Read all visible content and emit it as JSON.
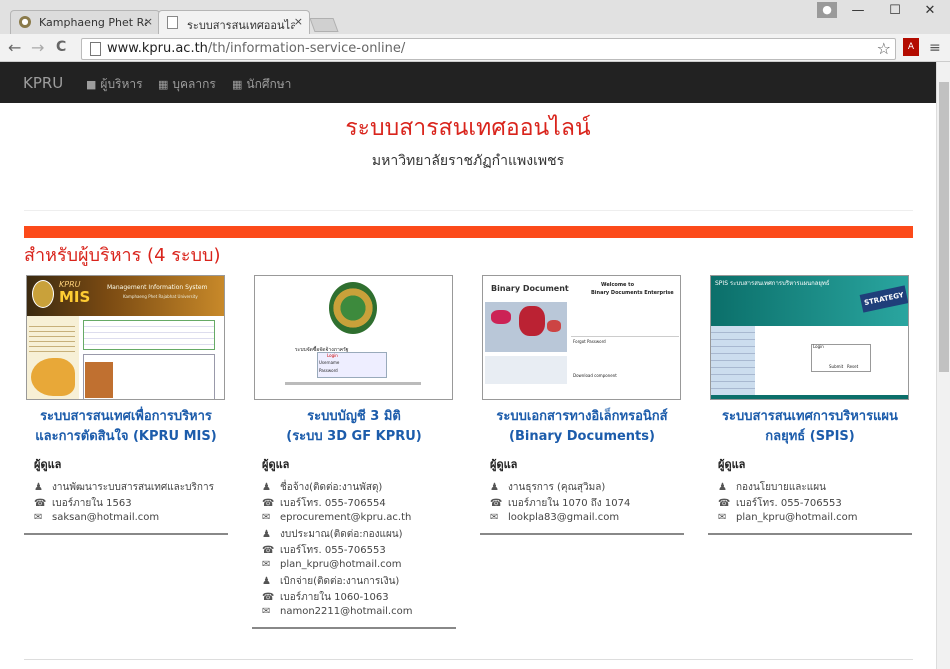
{
  "browser": {
    "tabs": [
      {
        "title": "Kamphaeng Phet Rajabha",
        "close": "×"
      },
      {
        "title": "ระบบสารสนเทศออนไลน์ - มหา",
        "close": "×"
      }
    ],
    "url_host": "www.kpru.ac.th",
    "url_path": "/th/information-service-online/",
    "back": "←",
    "forward": "→",
    "reload": "C",
    "star": "☆",
    "menu": "≡",
    "pdf": "A",
    "win_min": "—",
    "win_max": "☐",
    "win_close": "✕"
  },
  "navbar": {
    "brand": "KPRU",
    "links": [
      {
        "label": "ผู้บริหาร",
        "icon": "user-icon"
      },
      {
        "label": "บุคลากร",
        "icon": "grid-icon"
      },
      {
        "label": "นักศึกษา",
        "icon": "grid-icon"
      }
    ]
  },
  "header": {
    "title": "ระบบสารสนเทศออนไลน์",
    "subtitle": "มหาวิทยาลัยราชภัฏกำแพงเพชร"
  },
  "section": {
    "title": "สำหรับผู้บริหาร (4 ระบบ)"
  },
  "cards": [
    {
      "title1": "ระบบสารสนเทศเพื่อการบริหาร",
      "title2": "และการตัดสินใจ (KPRU MIS)",
      "contact_head": "ผู้ดูแล",
      "rows": [
        {
          "icon": "user-icon",
          "text": "งานพัฒนาระบบสารสนเทศและบริการ"
        },
        {
          "icon": "phone-icon",
          "text": "เบอร์ภายใน   1563"
        },
        {
          "icon": "envelope-icon",
          "text": "saksan@hotmail.com"
        }
      ]
    },
    {
      "title1": "ระบบบัญชี 3 มิติ",
      "title2": "(ระบบ 3D GF KPRU)",
      "contact_head": "ผู้ดูแล",
      "rows": [
        {
          "icon": "user-icon",
          "text": "ชื่อจ้าง(ติดต่อ:งานพัสดุ)"
        },
        {
          "icon": "phone-icon",
          "text": "เบอร์โทร.   055-706554"
        },
        {
          "icon": "envelope-icon",
          "text": "eprocurement@kpru.ac.th"
        },
        {
          "icon": "user-icon",
          "text": "งบประมาณ(ติดต่อ:กองแผน)"
        },
        {
          "icon": "phone-icon",
          "text": "เบอร์โทร.   055-706553"
        },
        {
          "icon": "envelope-icon",
          "text": "plan_kpru@hotmail.com"
        },
        {
          "icon": "user-icon",
          "text": "เบิกจ่าย(ติดต่อ:งานการเงิน)"
        },
        {
          "icon": "phone-icon",
          "text": "เบอร์ภายใน   1060-1063"
        },
        {
          "icon": "envelope-icon",
          "text": "namon2211@hotmail.com"
        }
      ]
    },
    {
      "title1": "ระบบเอกสารทางอิเล็กทรอนิกส์",
      "title2": "(Binary Documents)",
      "contact_head": "ผู้ดูแล",
      "rows": [
        {
          "icon": "user-icon",
          "text": "งานธุรการ   (คุณสุวิมล)"
        },
        {
          "icon": "phone-icon",
          "text": "เบอร์ภายใน   1070   ถึง   1074"
        },
        {
          "icon": "envelope-icon",
          "text": "lookpla83@gmail.com"
        }
      ]
    },
    {
      "title1": "ระบบสารสนเทศการบริหารแผน",
      "title2": "กลยุทธ์ (SPIS)",
      "contact_head": "ผู้ดูแล",
      "rows": [
        {
          "icon": "user-icon",
          "text": "กองนโยบายและแผน"
        },
        {
          "icon": "phone-icon",
          "text": "เบอร์โทร.   055-706553"
        },
        {
          "icon": "envelope-icon",
          "text": "plan_kpru@hotmail.com"
        }
      ]
    }
  ],
  "thumbs": {
    "mis": {
      "brand": "KPRU",
      "tag": "MIS",
      "header": "Management Information System",
      "sub": "Kamphaeng Phet Rajabhat University"
    },
    "gf": {
      "caption": "ระบบจัดซื้อจัดจ้างภาครัฐ",
      "login": "Login",
      "username": "Username",
      "password": "Password"
    },
    "binary": {
      "logo": "Binary Document",
      "welcome": "Welcome to",
      "product": "Binary Documents Enterprise",
      "forgot": "Forgot Password",
      "download": "Download component"
    },
    "spis": {
      "title": "SPIS ระบบสารสนเทศการบริหารแผนกลยุทธ์",
      "banner": "STRATEGY",
      "login": "Login",
      "submit": "Submit",
      "reset": "Reset"
    }
  },
  "colors": {
    "accent_red": "#d9241c",
    "bar_orange": "#fc4a1a",
    "link_blue": "#1c5cab",
    "navbar": "#222222"
  }
}
